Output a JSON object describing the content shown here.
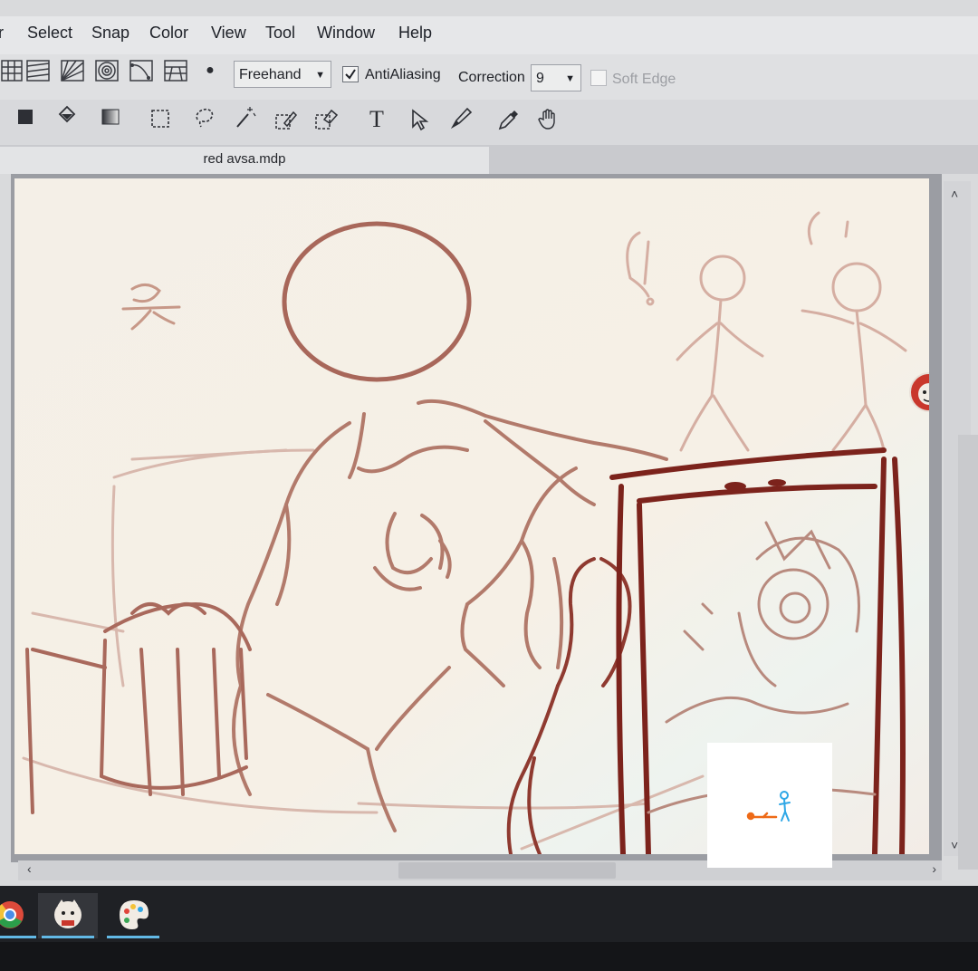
{
  "menu": {
    "items": [
      "r",
      "Select",
      "Snap",
      "Color",
      "View",
      "Tool",
      "Window",
      "Help"
    ]
  },
  "toolbar": {
    "brush_mode": "Freehand",
    "antialiasing_label": "AntiAliasing",
    "correction_label": "Correction",
    "correction_value": "9",
    "soft_edge_label": "Soft Edge",
    "text_tool_glyph": "T"
  },
  "document": {
    "tab_title": "red avsa.mdp"
  },
  "sketch": {
    "glyph": "유"
  },
  "taskbar": {
    "apps": [
      "chrome-icon",
      "firealpaca-icon",
      "paint-icon"
    ]
  },
  "colors": {
    "sketch_line": "#b17a6c",
    "sketch_dark": "#7f2c25",
    "canvas_bg": "#f4efe7",
    "accent_blue": "#2ea7e6",
    "accent_orange": "#ee6a17"
  }
}
